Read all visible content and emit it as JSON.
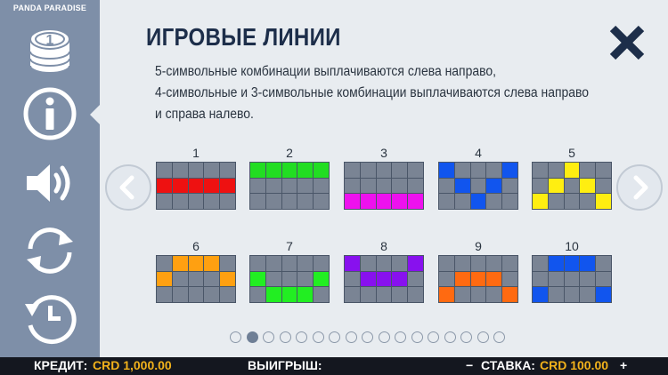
{
  "game_title": "PANDA PARADISE",
  "page_title": "ИГРОВЫЕ ЛИНИИ",
  "description_lines": [
    "5-символьные комбинации выплачиваются слева направо,",
    "4-символьные и 3-символьные комбинации выплачиваются слева направо",
    "и справа налево."
  ],
  "sidebar_icons": [
    "coins-icon",
    "info-icon",
    "speaker-icon",
    "autoplay-icon",
    "history-icon"
  ],
  "active_sidebar_icon": "info-icon",
  "close_icon": "close-icon",
  "nav_icons": {
    "prev": "chevron-left-icon",
    "next": "chevron-right-icon"
  },
  "paylines": [
    {
      "number": "1",
      "color": "#ee1111",
      "rows": [
        1,
        1,
        1,
        1,
        1
      ]
    },
    {
      "number": "2",
      "color": "#22dd22",
      "rows": [
        0,
        0,
        0,
        0,
        0
      ]
    },
    {
      "number": "3",
      "color": "#ee11ee",
      "rows": [
        2,
        2,
        2,
        2,
        2
      ]
    },
    {
      "number": "4",
      "color": "#1155ee",
      "rows": [
        0,
        1,
        2,
        1,
        0
      ]
    },
    {
      "number": "5",
      "color": "#ffee11",
      "rows": [
        2,
        1,
        0,
        1,
        2
      ]
    },
    {
      "number": "6",
      "color": "#ffa011",
      "rows": [
        1,
        0,
        0,
        0,
        1
      ]
    },
    {
      "number": "7",
      "color": "#22ee22",
      "rows": [
        1,
        2,
        2,
        2,
        1
      ]
    },
    {
      "number": "8",
      "color": "#8811ee",
      "rows": [
        0,
        1,
        1,
        1,
        0
      ]
    },
    {
      "number": "9",
      "color": "#ff6a11",
      "rows": [
        2,
        1,
        1,
        1,
        2
      ]
    },
    {
      "number": "10",
      "color": "#1155ee",
      "rows": [
        2,
        0,
        0,
        0,
        2
      ]
    }
  ],
  "pagination": {
    "total": 17,
    "current": 2
  },
  "bottom_bar": {
    "credit_label": "КРЕДИТ:",
    "credit_value": "CRD 1,000.00",
    "win_label": "ВЫИГРЫШ:",
    "minus_symbol": "−",
    "bet_label": "СТАВКА:",
    "bet_value": "CRD 100.00",
    "plus_symbol": "+"
  },
  "colors": {
    "sidebar": "#7e8fa8",
    "panel": "#e8ecf0",
    "title": "#1d2e4a",
    "accent": "#f2b21b"
  }
}
